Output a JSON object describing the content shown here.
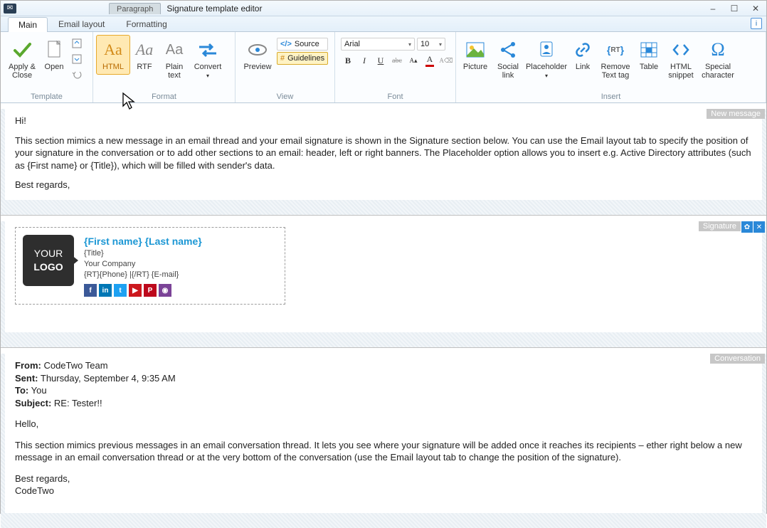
{
  "window": {
    "context_tab": "Paragraph",
    "title": "Signature template editor",
    "min": "–",
    "max": "☐",
    "close": "✕"
  },
  "tabs": {
    "main": "Main",
    "email_layout": "Email layout",
    "formatting": "Formatting"
  },
  "ribbon": {
    "template": {
      "title": "Template",
      "apply_close": "Apply & Close",
      "open": "Open"
    },
    "format": {
      "title": "Format",
      "html": "HTML",
      "rtf": "RTF",
      "plain": "Plain text",
      "convert": "Convert"
    },
    "view": {
      "title": "View",
      "preview": "Preview",
      "source": "Source",
      "guidelines": "Guidelines"
    },
    "font": {
      "title": "Font",
      "family": "Arial",
      "size": "10"
    },
    "insert": {
      "title": "Insert",
      "picture": "Picture",
      "social": "Social link",
      "placeholder": "Placeholder",
      "link": "Link",
      "remove_tag": "Remove Text tag",
      "table": "Table",
      "html_snippet": "HTML snippet",
      "special": "Special character"
    }
  },
  "sections": {
    "new_message": {
      "label": "New message",
      "greeting": "Hi!",
      "body": "This section mimics a new message in an email thread and your email signature is shown in the Signature section below. You can use the Email layout tab to specify the position of your signature in the conversation or to add other sections to an email: header, left or right banners. The Placeholder option allows you to insert e.g. Active Directory attributes (such as {First name} or {Title}), which will be filled with sender's data.",
      "signoff": "Best regards,"
    },
    "signature": {
      "label": "Signature",
      "name": "{First name} {Last name}",
      "title": "{Title}",
      "company": "Your Company",
      "phone": "{RT}{Phone} |{/RT} {E-mail}",
      "logo_top": "YOUR",
      "logo_bottom": "LOGO"
    },
    "conversation": {
      "label": "Conversation",
      "from_lbl": "From:",
      "from_val": " CodeTwo Team",
      "sent_lbl": "Sent:",
      "sent_val": " Thursday, September 4, 9:35 AM",
      "to_lbl": "To:",
      "to_val": " You",
      "subj_lbl": "Subject:",
      "subj_val": " RE: Tester!!",
      "hello": "Hello,",
      "body": "This section mimics previous messages in an email conversation thread. It lets you see where your signature will be added once it reaches its recipients – ether right below a new message in an email conversation thread or at the very bottom of the conversation (use the Email layout tab to change the position of the signature).",
      "sign1": "Best regards,",
      "sign2": "CodeTwo"
    }
  }
}
